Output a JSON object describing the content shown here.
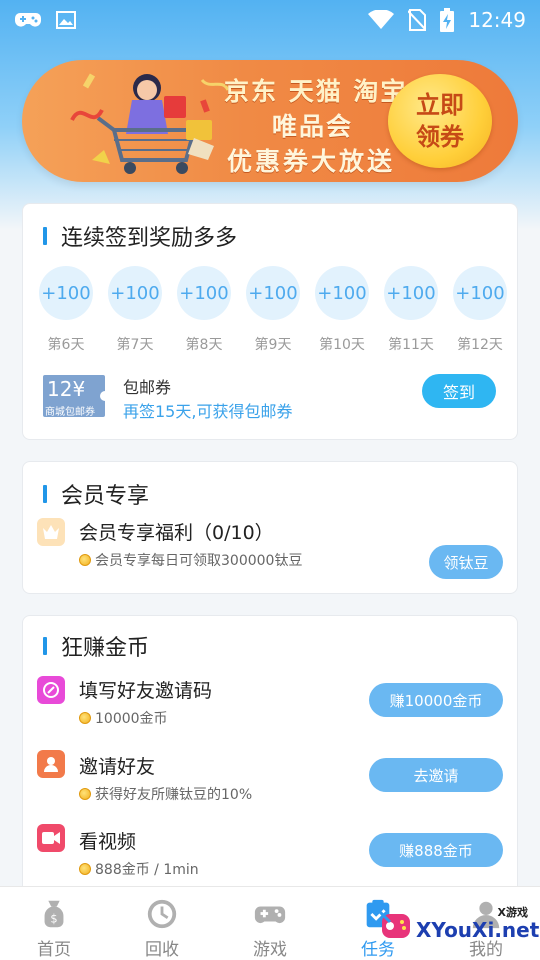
{
  "status_bar": {
    "time": "12:49",
    "left_icons": [
      "gamepad-icon",
      "image-icon"
    ],
    "right_icons": [
      "wifi-icon",
      "no-sim-icon",
      "battery-charging-icon"
    ]
  },
  "banner": {
    "line1": "京东 天猫 淘宝",
    "line2": "唯品会",
    "line3": "优惠券大放送",
    "cta_line1": "立即",
    "cta_line2": "领券"
  },
  "signin_card": {
    "title": "连续签到奖励多多",
    "days": [
      {
        "reward": "+100",
        "label": "第6天"
      },
      {
        "reward": "+100",
        "label": "第7天"
      },
      {
        "reward": "+100",
        "label": "第8天"
      },
      {
        "reward": "+100",
        "label": "第9天"
      },
      {
        "reward": "+100",
        "label": "第10天"
      },
      {
        "reward": "+100",
        "label": "第11天"
      },
      {
        "reward": "+100",
        "label": "第12天"
      }
    ],
    "coupon": {
      "amount": "12¥",
      "sub": "商城包邮券",
      "title": "包邮券",
      "desc": "再签15天,可获得包邮券"
    },
    "button": "签到"
  },
  "member_card": {
    "title": "会员专享",
    "item": {
      "title": "会员专享福利（0/10）",
      "sub": "会员专享每日可领取300000钛豆",
      "button": "领钛豆"
    }
  },
  "earn_card": {
    "title": "狂赚金币",
    "items": [
      {
        "title": "填写好友邀请码",
        "sub": "10000金币",
        "button": "赚10000金币",
        "icon": "edit-icon",
        "color": "#e84ad8"
      },
      {
        "title": "邀请好友",
        "sub": "获得好友所赚钛豆的10%",
        "button": "去邀请",
        "icon": "user-icon",
        "color": "#f27a4a"
      },
      {
        "title": "看视频",
        "sub": "888金币 / 1min",
        "button": "赚888金币",
        "icon": "video-icon",
        "color": "#f04a6a"
      }
    ]
  },
  "tabbar": {
    "tabs": [
      {
        "label": "首页",
        "icon": "money-bag-icon"
      },
      {
        "label": "回收",
        "icon": "clock-icon"
      },
      {
        "label": "游戏",
        "icon": "gamepad-icon"
      },
      {
        "label": "任务",
        "icon": "task-icon"
      },
      {
        "label": "我的",
        "icon": "profile-icon"
      }
    ],
    "active_index": 3
  },
  "watermark": {
    "small": "X游戏",
    "big": "XYouXi.net"
  },
  "colors": {
    "accent": "#2fb6f2",
    "blue_bar": "#2196e8",
    "button": "#6ab8f2"
  }
}
